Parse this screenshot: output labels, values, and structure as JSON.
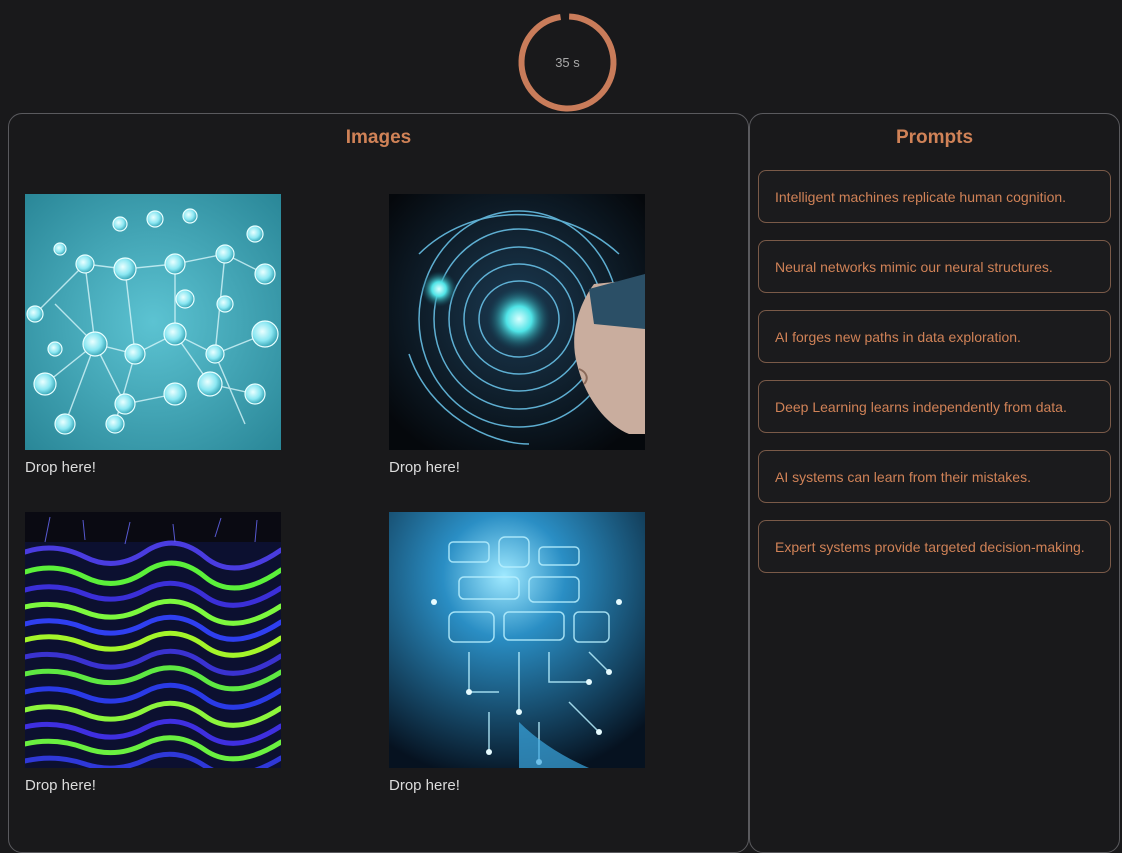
{
  "timer": {
    "label": "35 s",
    "progress": 0.97
  },
  "images_panel": {
    "title": "Images",
    "cells": [
      {
        "drop_label": "Drop here!",
        "image": "neural-network-cells"
      },
      {
        "drop_label": "Drop here!",
        "image": "ai-head-circuit-profile"
      },
      {
        "drop_label": "Drop here!",
        "image": "psychedelic-data-landscape"
      },
      {
        "drop_label": "Drop here!",
        "image": "circuit-brain-head"
      }
    ]
  },
  "prompts_panel": {
    "title": "Prompts",
    "items": [
      "Intelligent machines replicate human cognition.",
      "Neural networks mimic our neural structures.",
      "AI forges new paths in data exploration.",
      "Deep Learning learns independently from data.",
      "AI systems can learn from their mistakes.",
      "Expert systems provide targeted decision-making."
    ]
  },
  "colors": {
    "background": "#19191b",
    "accent": "#d08257",
    "timer_ring": "#c97c5a",
    "panel_border": "#5a5a5e"
  }
}
